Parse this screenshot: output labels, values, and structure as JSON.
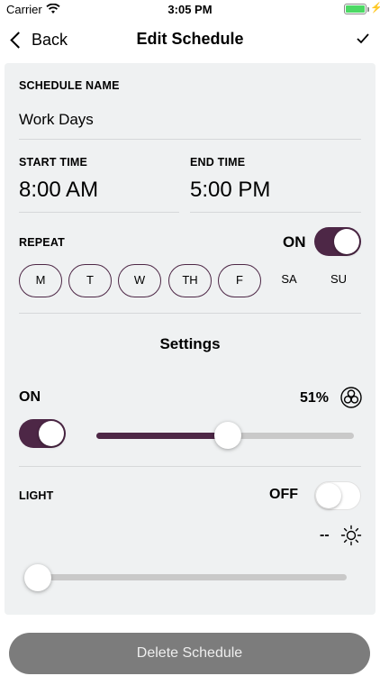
{
  "status_bar": {
    "carrier": "Carrier",
    "time": "3:05 PM",
    "battery_level": 1.0
  },
  "nav": {
    "back_label": "Back",
    "title": "Edit Schedule",
    "confirm_icon": "checkmark-icon"
  },
  "schedule_name": {
    "label": "SCHEDULE NAME",
    "value": "Work Days"
  },
  "start_time": {
    "label": "START TIME",
    "value": "8:00 AM"
  },
  "end_time": {
    "label": "END TIME",
    "value": "5:00 PM"
  },
  "repeat": {
    "label": "REPEAT",
    "state_text": "ON",
    "enabled": true,
    "days": [
      {
        "label": "M",
        "selected": true
      },
      {
        "label": "T",
        "selected": true
      },
      {
        "label": "W",
        "selected": true
      },
      {
        "label": "TH",
        "selected": true
      },
      {
        "label": "F",
        "selected": true
      },
      {
        "label": "SA",
        "selected": false
      },
      {
        "label": "SU",
        "selected": false
      }
    ]
  },
  "settings": {
    "title": "Settings",
    "fan": {
      "state_text": "ON",
      "enabled": true,
      "level_text": "51%",
      "level": 0.51,
      "icon": "fan-icon"
    },
    "light": {
      "label": "LIGHT",
      "state_text": "OFF",
      "enabled": false,
      "level_text": "--",
      "level": 0.0,
      "icon": "sun-icon"
    }
  },
  "delete_button": {
    "label": "Delete Schedule"
  },
  "colors": {
    "accent": "#4d2746",
    "card_bg": "#eff1f2",
    "delete_bg": "#7c7c7c",
    "battery": "#4cd964"
  }
}
